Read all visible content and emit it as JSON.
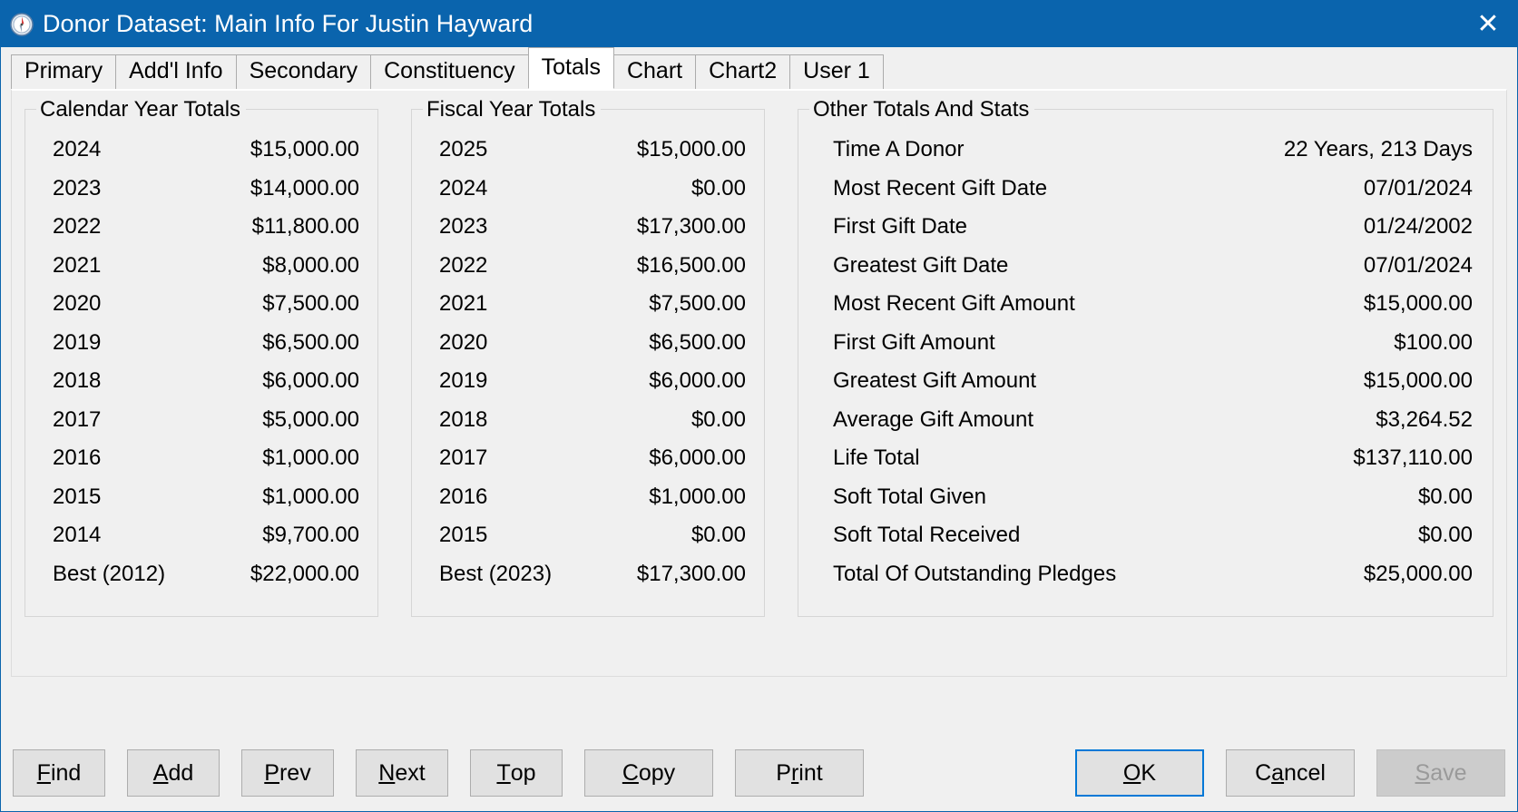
{
  "window": {
    "title": "Donor Dataset: Main Info For Justin Hayward",
    "icon": "compass-icon",
    "close_label": "✕",
    "accent_color": "#0a64ad",
    "face_color": "#f0f0f0"
  },
  "tabs": [
    {
      "label": "Primary",
      "active": false
    },
    {
      "label": "Add'l Info",
      "active": false
    },
    {
      "label": "Secondary",
      "active": false
    },
    {
      "label": "Constituency",
      "active": false
    },
    {
      "label": "Totals",
      "active": true
    },
    {
      "label": "Chart",
      "active": false
    },
    {
      "label": "Chart2",
      "active": false
    },
    {
      "label": "User 1",
      "active": false
    }
  ],
  "calendar_year_totals": {
    "title": "Calendar Year Totals",
    "rows": [
      {
        "label": "2024",
        "value": "$15,000.00"
      },
      {
        "label": "2023",
        "value": "$14,000.00"
      },
      {
        "label": "2022",
        "value": "$11,800.00"
      },
      {
        "label": "2021",
        "value": "$8,000.00"
      },
      {
        "label": "2020",
        "value": "$7,500.00"
      },
      {
        "label": "2019",
        "value": "$6,500.00"
      },
      {
        "label": "2018",
        "value": "$6,000.00"
      },
      {
        "label": "2017",
        "value": "$5,000.00"
      },
      {
        "label": "2016",
        "value": "$1,000.00"
      },
      {
        "label": "2015",
        "value": "$1,000.00"
      },
      {
        "label": "2014",
        "value": "$9,700.00"
      },
      {
        "label": "Best (2012)",
        "value": "$22,000.00"
      }
    ]
  },
  "fiscal_year_totals": {
    "title": "Fiscal Year Totals",
    "rows": [
      {
        "label": "2025",
        "value": "$15,000.00"
      },
      {
        "label": "2024",
        "value": "$0.00"
      },
      {
        "label": "2023",
        "value": "$17,300.00"
      },
      {
        "label": "2022",
        "value": "$16,500.00"
      },
      {
        "label": "2021",
        "value": "$7,500.00"
      },
      {
        "label": "2020",
        "value": "$6,500.00"
      },
      {
        "label": "2019",
        "value": "$6,000.00"
      },
      {
        "label": "2018",
        "value": "$0.00"
      },
      {
        "label": "2017",
        "value": "$6,000.00"
      },
      {
        "label": "2016",
        "value": "$1,000.00"
      },
      {
        "label": "2015",
        "value": "$0.00"
      },
      {
        "label": "Best (2023)",
        "value": "$17,300.00"
      }
    ]
  },
  "other_totals_and_stats": {
    "title": "Other Totals And Stats",
    "rows": [
      {
        "label": "Time A Donor",
        "value": "22 Years, 213 Days"
      },
      {
        "label": "Most Recent Gift Date",
        "value": "07/01/2024"
      },
      {
        "label": "First Gift Date",
        "value": "01/24/2002"
      },
      {
        "label": "Greatest Gift Date",
        "value": "07/01/2024"
      },
      {
        "label": "Most Recent Gift Amount",
        "value": "$15,000.00"
      },
      {
        "label": "First Gift Amount",
        "value": "$100.00"
      },
      {
        "label": "Greatest Gift Amount",
        "value": "$15,000.00"
      },
      {
        "label": "Average Gift Amount",
        "value": "$3,264.52"
      },
      {
        "label": "Life Total",
        "value": "$137,110.00"
      },
      {
        "label": "Soft Total Given",
        "value": "$0.00"
      },
      {
        "label": "Soft Total Received",
        "value": "$0.00"
      },
      {
        "label": "Total Of Outstanding Pledges",
        "value": "$25,000.00"
      }
    ]
  },
  "buttons": {
    "left": [
      {
        "pre": "",
        "key": "F",
        "post": "ind",
        "name": "find-button"
      },
      {
        "pre": "",
        "key": "A",
        "post": "dd",
        "name": "add-button"
      },
      {
        "pre": "",
        "key": "P",
        "post": "rev",
        "name": "prev-button"
      },
      {
        "pre": "",
        "key": "N",
        "post": "ext",
        "name": "next-button"
      },
      {
        "pre": "",
        "key": "T",
        "post": "op",
        "name": "top-button"
      },
      {
        "pre": "",
        "key": "C",
        "post": "opy",
        "name": "copy-button"
      },
      {
        "pre": "P",
        "key": "r",
        "post": "int",
        "name": "print-button"
      }
    ],
    "right": [
      {
        "pre": "",
        "key": "O",
        "post": "K",
        "name": "ok-button",
        "state": "focused"
      },
      {
        "pre": "C",
        "key": "a",
        "post": "ncel",
        "name": "cancel-button",
        "state": "normal"
      },
      {
        "pre": "",
        "key": "S",
        "post": "ave",
        "name": "save-button",
        "state": "disabled"
      }
    ]
  }
}
